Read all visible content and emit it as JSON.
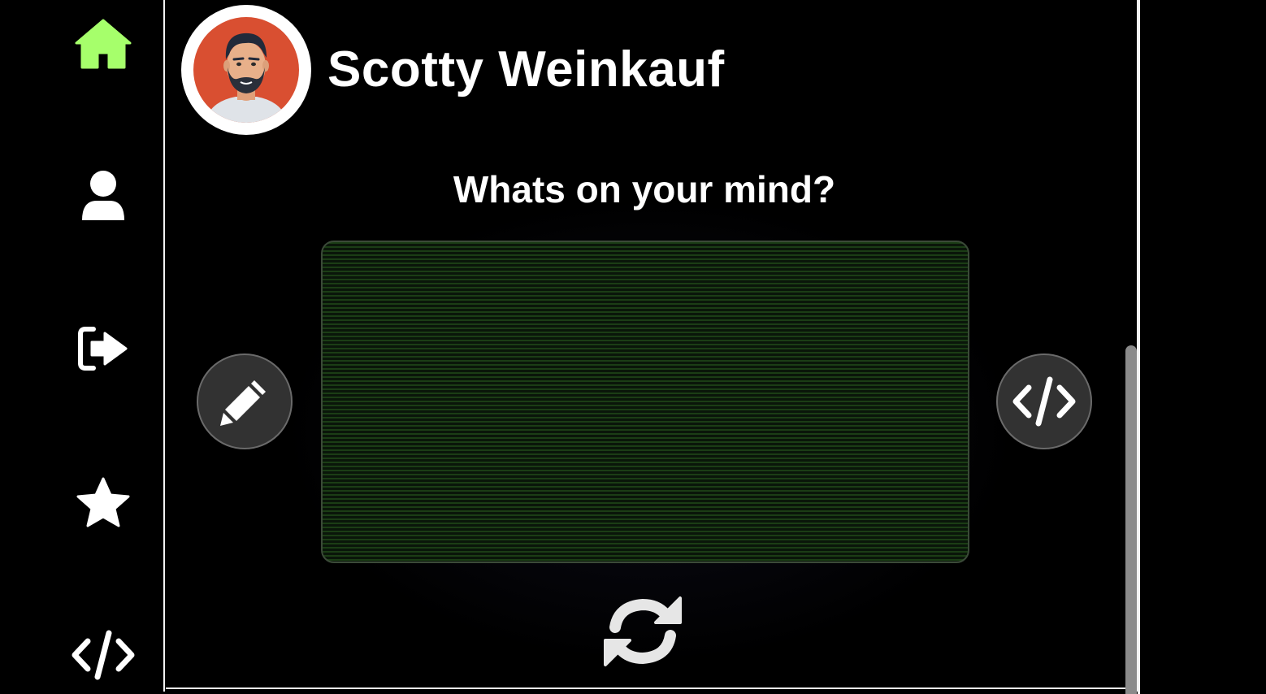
{
  "sidebar": {
    "items": [
      {
        "icon": "home-icon",
        "color": "#a6ff6b",
        "active": true
      },
      {
        "icon": "user-icon",
        "color": "#ffffff",
        "active": false
      },
      {
        "icon": "sign-out-icon",
        "color": "#ffffff",
        "active": false
      },
      {
        "icon": "star-icon",
        "color": "#ffffff",
        "active": false
      },
      {
        "icon": "code-icon",
        "color": "#ffffff",
        "active": false
      }
    ]
  },
  "profile": {
    "name": "Scotty Weinkauf",
    "avatar_icon": "avatar-illustration"
  },
  "composer": {
    "heading": "Whats on your mind?",
    "text_value": "",
    "edit_button_icon": "pencil-icon",
    "code_button_icon": "code-icon",
    "refresh_button_icon": "refresh-icon"
  },
  "colors": {
    "accent": "#a6ff6b",
    "textarea_green": "#1b3d15",
    "button_bg": "#323232"
  }
}
